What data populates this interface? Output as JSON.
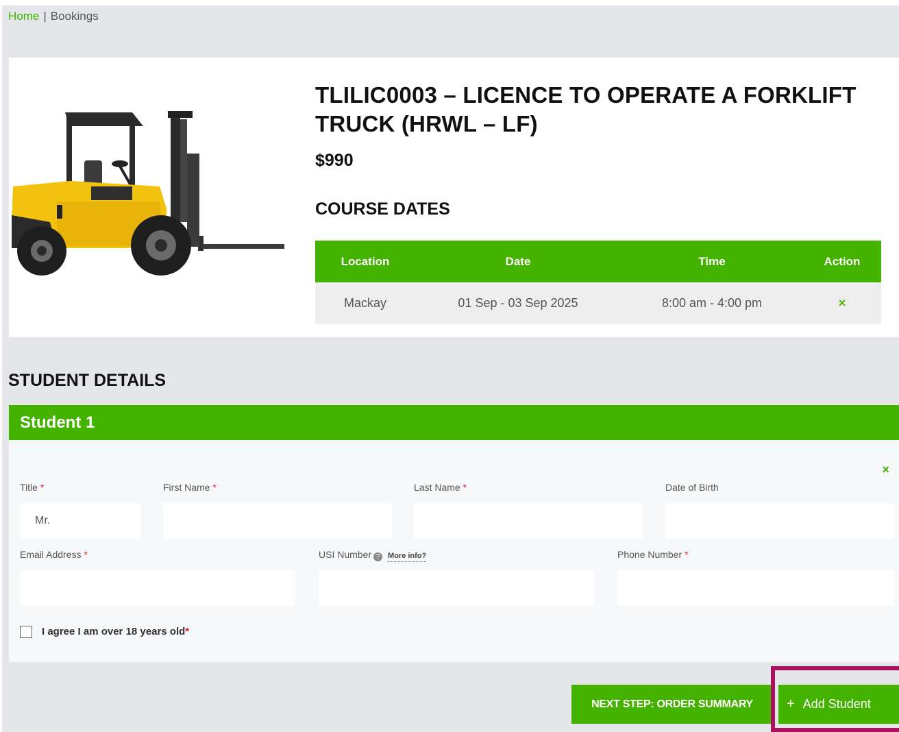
{
  "breadcrumb": {
    "home": "Home",
    "separator": "|",
    "current": "Bookings"
  },
  "course": {
    "title": "TLILIC0003 – LICENCE TO OPERATE A FORKLIFT TRUCK (HRWL – LF)",
    "price": "$990",
    "image_icon": "forklift-image",
    "dates_heading": "COURSE DATES",
    "table": {
      "headers": [
        "Location",
        "Date",
        "Time",
        "Action"
      ],
      "rows": [
        {
          "location": "Mackay",
          "date": "01 Sep - 03 Sep 2025",
          "time": "8:00 am - 4:00 pm",
          "action": "×"
        }
      ]
    }
  },
  "students": {
    "heading": "STUDENT DETAILS",
    "student_label": "Student  1",
    "remove": "×",
    "fields": {
      "title": {
        "label": "Title",
        "value": "Mr."
      },
      "first_name": {
        "label": "First Name",
        "value": ""
      },
      "last_name": {
        "label": "Last Name",
        "value": ""
      },
      "dob": {
        "label": "Date of Birth",
        "value": ""
      },
      "email": {
        "label": "Email Address",
        "value": ""
      },
      "usi": {
        "label": "USI Number",
        "help": "?",
        "more_info": "More info?",
        "value": ""
      },
      "phone": {
        "label": "Phone Number",
        "value": ""
      }
    },
    "required_marker": "*",
    "agree_label": "I agree I am over 18 years old"
  },
  "actions": {
    "next_step": "NEXT STEP: ORDER SUMMARY",
    "add_student_icon": "+",
    "add_student": "Add Student"
  },
  "colors": {
    "accent_green": "#44b300",
    "required_red": "#e0262e",
    "highlight": "#a8125e"
  }
}
